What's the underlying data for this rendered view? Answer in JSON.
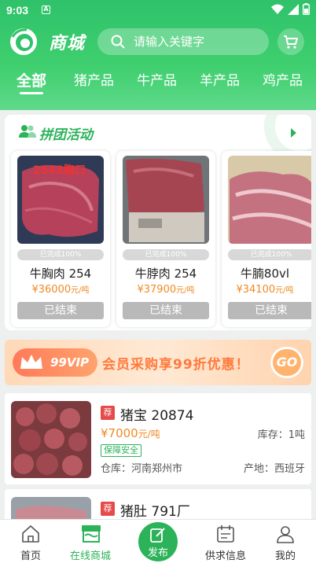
{
  "status_bar": {
    "time": "9:03",
    "notification_badge": "A"
  },
  "header": {
    "brand": "商城",
    "search_placeholder": "请输入关键字",
    "tabs": [
      "全部",
      "猪产品",
      "牛产品",
      "羊产品",
      "鸡产品"
    ],
    "active_tab": 0
  },
  "group_buy": {
    "title": "拼团活动",
    "products": [
      {
        "image_overlay": "2543胸口",
        "progress": "已完成100%",
        "name": "牛胸肉 254",
        "price": "¥36000",
        "unit": "元/吨",
        "button": "已结束"
      },
      {
        "image_overlay": "",
        "progress": "已完成100%",
        "name": "牛脖肉 254",
        "price": "¥37900",
        "unit": "元/吨",
        "button": "已结束"
      },
      {
        "image_overlay": "",
        "progress": "已完成100%",
        "name": "牛腩80vl",
        "price": "¥34100",
        "unit": "元/吨",
        "button": "已结束"
      }
    ]
  },
  "vip_banner": {
    "badge": "99VIP",
    "text": "会员采购享99折优惠！",
    "go": "GO"
  },
  "items": [
    {
      "tag": "荐",
      "title": "猪宝 20874",
      "price": "¥7000",
      "unit": "元/吨",
      "stock": "库存：1吨",
      "safe": "保障安全",
      "warehouse": "仓库：河南郑州市",
      "origin": "产地：西班牙"
    },
    {
      "tag": "荐",
      "title": "猪肚 791厂"
    }
  ],
  "bottom_nav": {
    "items": [
      "首页",
      "在线商城",
      "发布",
      "供求信息",
      "我的"
    ],
    "active": 1
  },
  "colors": {
    "primary": "#2cb35a",
    "price": "#f08a24",
    "tag": "#e64a4a"
  }
}
